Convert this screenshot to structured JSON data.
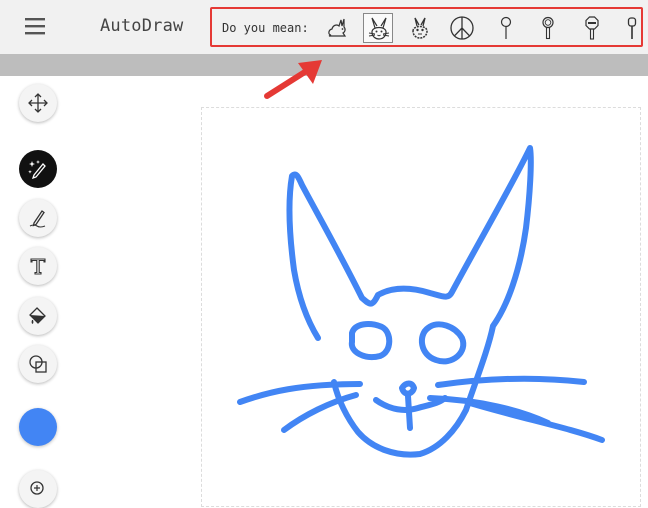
{
  "app": {
    "title": "AutoDraw"
  },
  "suggestions": {
    "label": "Do you mean:",
    "items": [
      {
        "icon": "rabbit-sitting-icon"
      },
      {
        "icon": "bunny-face-icon",
        "selected": true
      },
      {
        "icon": "bunny-face-fuzzy-icon"
      },
      {
        "icon": "peace-sign-icon"
      },
      {
        "icon": "lollipop-icon"
      },
      {
        "icon": "sign-smiley-icon"
      },
      {
        "icon": "stop-sign-icon"
      },
      {
        "icon": "sign-post-icon"
      }
    ]
  },
  "toolbar": {
    "tools": [
      {
        "icon": "move-arrows-icon"
      },
      {
        "icon": "autodraw-sparkle-pencil-icon",
        "active": true
      },
      {
        "icon": "pen-icon"
      },
      {
        "icon": "text-icon"
      },
      {
        "icon": "fill-bucket-icon"
      },
      {
        "icon": "shapes-icon"
      }
    ],
    "color": "#4285f4",
    "zoom_icon": "zoom-icon"
  },
  "canvas": {
    "stroke_color": "#4285f4",
    "drawing_subject": "cat face doodle"
  },
  "colors": {
    "highlight": "#e53935",
    "arrow": "#e53935"
  }
}
